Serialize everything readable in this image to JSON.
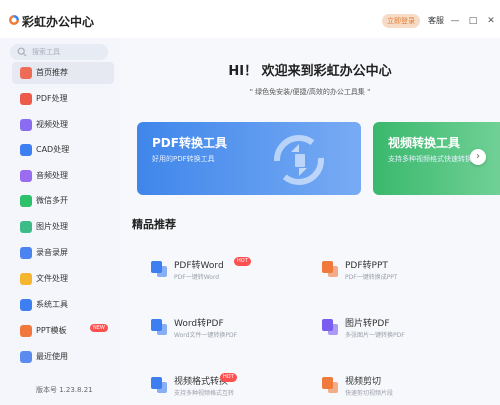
{
  "app": {
    "title": "彩虹办公中心",
    "login_label": "立即登录",
    "help_label": "客服",
    "minimize": "—",
    "maximize": "□",
    "close": "✕"
  },
  "sidebar": {
    "search_placeholder": "搜索工具",
    "items": [
      {
        "label": "首页推荐",
        "icon": "home-icon",
        "color": "#ee6b56"
      },
      {
        "label": "PDF处理",
        "icon": "pdf-icon",
        "color": "#ee5a4a"
      },
      {
        "label": "视频处理",
        "icon": "video-icon",
        "color": "#8a6cf0"
      },
      {
        "label": "CAD处理",
        "icon": "cad-icon",
        "color": "#3d7ff0"
      },
      {
        "label": "音频处理",
        "icon": "audio-icon",
        "color": "#9a6cf0"
      },
      {
        "label": "微信多开",
        "icon": "wechat-icon",
        "color": "#2ec06b"
      },
      {
        "label": "图片处理",
        "icon": "image-icon",
        "color": "#3dbb88"
      },
      {
        "label": "录音录屏",
        "icon": "record-icon",
        "color": "#4b83f0"
      },
      {
        "label": "文件处理",
        "icon": "folder-icon",
        "color": "#f5b52e"
      },
      {
        "label": "系统工具",
        "icon": "system-icon",
        "color": "#3d7ff0"
      },
      {
        "label": "PPT模板",
        "icon": "ppt-icon",
        "color": "#f0783c",
        "badge": "NEW"
      },
      {
        "label": "最近使用",
        "icon": "recent-icon",
        "color": "#5a8cf0"
      }
    ],
    "version": "版本号 1.23.8.21"
  },
  "main": {
    "welcome": "HI！ 欢迎来到彩虹办公中心",
    "subtitle": "\" 绿色免安装/便捷/高效的办公工具集 \"",
    "banners": [
      {
        "title": "PDF转换工具",
        "subtitle": "好用的PDF转换工具"
      },
      {
        "title": "视频转换工具",
        "subtitle": "支持多种视频格式快速转换"
      }
    ],
    "section_title": "精品推荐",
    "tools": [
      {
        "name": "PDF转Word",
        "desc": "PDF一键转Word",
        "icon": "pdf-to-word-icon",
        "color": "#3d7ff0",
        "badge": "HOT"
      },
      {
        "name": "PDF转PPT",
        "desc": "PDF一键转换成PPT",
        "icon": "pdf-to-ppt-icon",
        "color": "#f07a3c"
      },
      {
        "name": "Word转PDF",
        "desc": "Word文件一键转换PDF",
        "icon": "word-to-pdf-icon",
        "color": "#3d7ff0"
      },
      {
        "name": "图片转PDF",
        "desc": "多张图片一键转换PDF",
        "icon": "image-to-pdf-icon",
        "color": "#7a5cf0"
      },
      {
        "name": "视频格式转换",
        "desc": "支持多种视频格式互转",
        "icon": "video-convert-icon",
        "color": "#3d7ff0",
        "badge": "HOT"
      },
      {
        "name": "视频剪切",
        "desc": "快速剪切视频片段",
        "icon": "video-cut-icon",
        "color": "#f07a3c"
      }
    ]
  },
  "colors": {
    "accent": "#3f86ea",
    "green": "#3ab86d",
    "badge": "#ff5050",
    "login_bg": "#f6dcc6"
  }
}
